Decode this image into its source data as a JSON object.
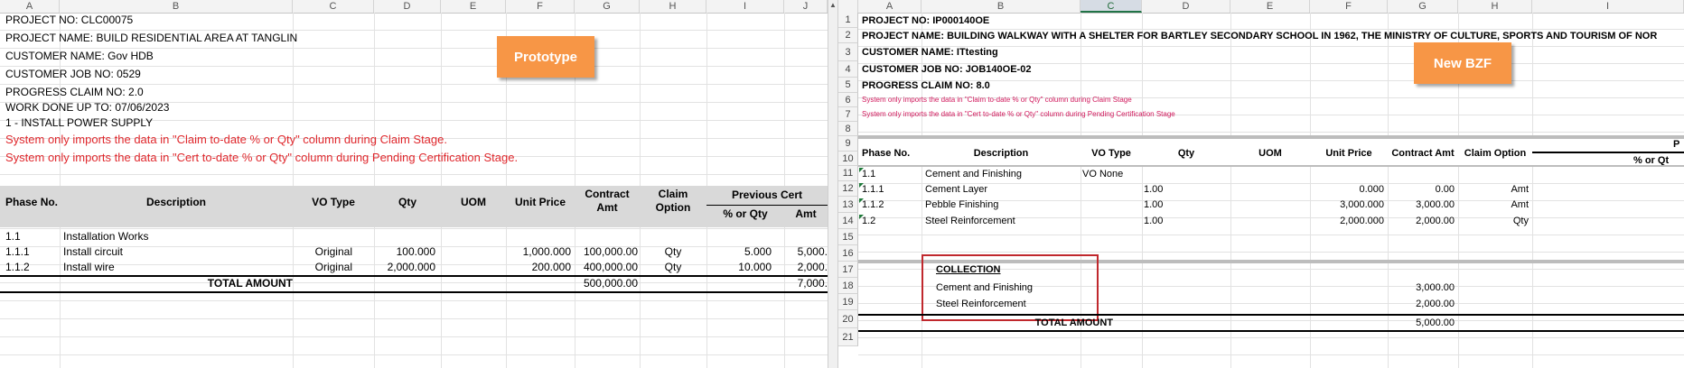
{
  "left": {
    "columns": [
      "A",
      "B",
      "C",
      "D",
      "E",
      "F",
      "G",
      "H",
      "I",
      "J"
    ],
    "info": [
      "PROJECT NO: CLC00075",
      "PROJECT NAME: BUILD RESIDENTIAL AREA AT TANGLIN",
      "CUSTOMER NAME: Gov HDB",
      "CUSTOMER JOB NO: 0529",
      "PROGRESS CLAIM NO: 2.0",
      "WORK DONE UP TO: 07/06/2023",
      "1 - INSTALL POWER SUPPLY"
    ],
    "notes": [
      "System only imports the data in \"Claim to-date % or Qty\" column during Claim Stage.",
      "System only imports the data in \"Cert to-date % or Qty\" column during Pending Certification Stage."
    ],
    "label_box": "Prototype",
    "headers": {
      "phase": "Phase No.",
      "desc": "Description",
      "vo": "VO Type",
      "qty": "Qty",
      "uom": "UOM",
      "price": "Unit Price",
      "contract": "Contract Amt",
      "claim": "Claim Option",
      "prev": "Previous Cert",
      "pct": "% or Qty",
      "amt": "Amt"
    },
    "rows": [
      {
        "phase": "1.1",
        "desc": "Installation Works",
        "vo": "",
        "qty": "",
        "uom": "",
        "price": "",
        "contract": "",
        "claim": "",
        "pct": "",
        "amt": ""
      },
      {
        "phase": "1.1.1",
        "desc": "Install circuit",
        "vo": "Original",
        "qty": "100.000",
        "uom": "",
        "price": "1,000.000",
        "contract": "100,000.00",
        "claim": "Qty",
        "pct": "5.000",
        "amt": "5,000."
      },
      {
        "phase": "1.1.2",
        "desc": "Install wire",
        "vo": "Original",
        "qty": "2,000.000",
        "uom": "",
        "price": "200.000",
        "contract": "400,000.00",
        "claim": "Qty",
        "pct": "10.000",
        "amt": "2,000."
      }
    ],
    "total_label": "TOTAL AMOUNT",
    "total_contract": "500,000.00",
    "total_amt": "7,000."
  },
  "right": {
    "columns": [
      "A",
      "B",
      "C",
      "D",
      "E",
      "F",
      "G",
      "H",
      "I"
    ],
    "row_numbers": [
      "1",
      "2",
      "3",
      "4",
      "5",
      "6",
      "7",
      "8",
      "9",
      "10",
      "11",
      "12",
      "13",
      "14",
      "15",
      "16",
      "17",
      "18",
      "19",
      "20",
      "21"
    ],
    "info": [
      "PROJECT NO: IP000140OE",
      "PROJECT NAME: BUILDING WALKWAY WITH A SHELTER FOR BARTLEY SECONDARY SCHOOL IN 1962, THE MINISTRY OF CULTURE, SPORTS AND TOURISM OF NOR",
      "CUSTOMER NAME: ITtesting",
      "CUSTOMER JOB NO: JOB140OE-02",
      "PROGRESS CLAIM NO: 8.0"
    ],
    "notes": [
      "System only imports the data in \"Claim to-date % or Qty\" column during Claim Stage",
      "System only imports the data in \"Cert to-date % or Qty\" column during Pending Certification Stage"
    ],
    "label_box": "New BZF",
    "headers": {
      "phase": "Phase No.",
      "desc": "Description",
      "vo": "VO Type",
      "qty": "Qty",
      "uom": "UOM",
      "price": "Unit Price",
      "contract": "Contract Amt",
      "claim": "Claim Option",
      "prev_cut": "P",
      "pct_cut": "% or Qt"
    },
    "rows": [
      {
        "phase": "1.1",
        "desc": "Cement and Finishing",
        "vo": "VO None",
        "qty": "",
        "uom": "",
        "price": "",
        "contract": "",
        "claim": ""
      },
      {
        "phase": "1.1.1",
        "desc": "Cement Layer",
        "vo": "",
        "qty": "1.00",
        "uom": "",
        "price": "0.000",
        "contract": "0.00",
        "claim": "Amt"
      },
      {
        "phase": "1.1.2",
        "desc": "Pebble Finishing",
        "vo": "",
        "qty": "1.00",
        "uom": "",
        "price": "3,000.000",
        "contract": "3,000.00",
        "claim": "Amt"
      },
      {
        "phase": "1.2",
        "desc": "Steel Reinforcement",
        "vo": "",
        "qty": "1.00",
        "uom": "",
        "price": "2,000.000",
        "contract": "2,000.00",
        "claim": "Qty"
      }
    ],
    "collection_title": "COLLECTION",
    "collection": [
      {
        "desc": "Cement and Finishing",
        "amount": "3,000.00"
      },
      {
        "desc": "Steel Reinforcement",
        "amount": "2,000.00"
      }
    ],
    "total_label": "TOTAL AMOUNT",
    "total_contract": "5,000.00"
  }
}
